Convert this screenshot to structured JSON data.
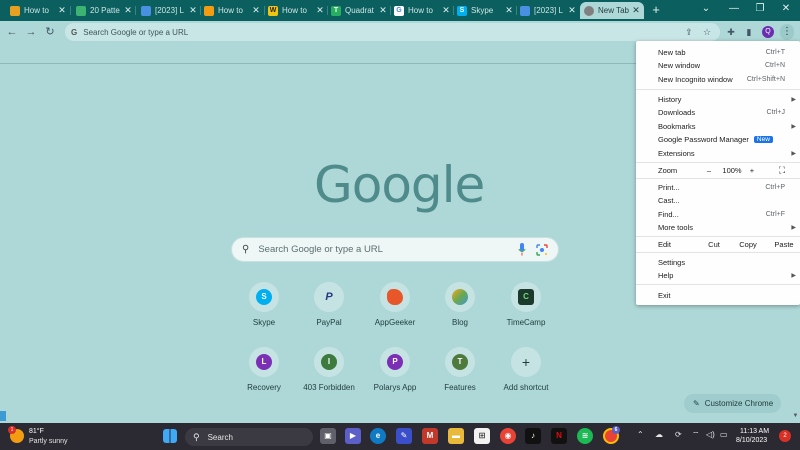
{
  "tabs": [
    {
      "label": "How to",
      "favicon_color": "#e8a020",
      "icon": "globe-icon"
    },
    {
      "label": "20 Patte",
      "favicon_color": "#3cb371",
      "icon": "leaf-icon"
    },
    {
      "label": "[2023] L",
      "favicon_color": "#4a90e2",
      "icon": "doc-icon"
    },
    {
      "label": "How to",
      "favicon_color": "#f39c12",
      "icon": "triangle-icon"
    },
    {
      "label": "How to",
      "favicon_color": "#f1c40f",
      "icon": "w-icon"
    },
    {
      "label": "Quadrat",
      "favicon_color": "#27ae60",
      "icon": "sheet-icon"
    },
    {
      "label": "How to",
      "favicon_color": "#4285f4",
      "icon": "google-g-icon"
    },
    {
      "label": "Skype",
      "favicon_color": "#00aff0",
      "icon": "skype-icon"
    },
    {
      "label": "[2023] L",
      "favicon_color": "#4a90e2",
      "icon": "doc-icon"
    },
    {
      "label": "New Tab",
      "favicon_color": "#808080",
      "icon": "chrome-icon",
      "active": true
    }
  ],
  "window_controls": {
    "search": "⌄",
    "minimize": "—",
    "restore": "❐",
    "close": "✕"
  },
  "toolbar": {
    "back": "←",
    "forward": "→",
    "reload": "↻",
    "omnibox_placeholder": "Search Google or type a URL",
    "omnibox_icon": "G",
    "profile_initial": "Q"
  },
  "page": {
    "logo_text": "Google",
    "search_placeholder": "Search Google or type a URL",
    "customize_label": "Customize Chrome"
  },
  "shortcuts": [
    {
      "label": "Skype",
      "glyph": "S",
      "color": "#00aff0"
    },
    {
      "label": "PayPal",
      "glyph": "P",
      "color": "#253b80"
    },
    {
      "label": "AppGeeker",
      "glyph": "",
      "color": "#e8572a"
    },
    {
      "label": "Blog",
      "glyph": "",
      "color": "#6aa84f"
    },
    {
      "label": "TimeCamp",
      "glyph": "C",
      "color": "#1b3a2b"
    },
    {
      "label": "Recovery",
      "glyph": "L",
      "color": "#7b2fb5"
    },
    {
      "label": "403 Forbidden",
      "glyph": "I",
      "color": "#3d7a3d"
    },
    {
      "label": "Polarys App",
      "glyph": "P",
      "color": "#7b2fb5"
    },
    {
      "label": "Features",
      "glyph": "T",
      "color": "#4f7a3d"
    },
    {
      "label": "Add shortcut",
      "glyph": "+",
      "color": "#c6e3e3"
    }
  ],
  "menu": {
    "new_tab": "New tab",
    "new_tab_key": "Ctrl+T",
    "new_window": "New window",
    "new_window_key": "Ctrl+N",
    "new_incognito": "New Incognito window",
    "new_incognito_key": "Ctrl+Shift+N",
    "history": "History",
    "downloads": "Downloads",
    "downloads_key": "Ctrl+J",
    "bookmarks": "Bookmarks",
    "password_manager": "Google Password Manager",
    "password_badge": "New",
    "extensions": "Extensions",
    "zoom": "Zoom",
    "zoom_minus": "–",
    "zoom_value": "100%",
    "zoom_plus": "+",
    "print": "Print...",
    "print_key": "Ctrl+P",
    "cast": "Cast...",
    "find": "Find...",
    "find_key": "Ctrl+F",
    "more_tools": "More tools",
    "edit": "Edit",
    "cut": "Cut",
    "copy": "Copy",
    "paste": "Paste",
    "settings": "Settings",
    "help": "Help",
    "exit": "Exit"
  },
  "taskbar": {
    "temperature": "81°F",
    "condition": "Partly sunny",
    "weather_badge": "1",
    "search_label": "Search",
    "time": "11:13 AM",
    "date": "8/10/2023",
    "notification_count": "2",
    "chrome_badge": "6"
  }
}
